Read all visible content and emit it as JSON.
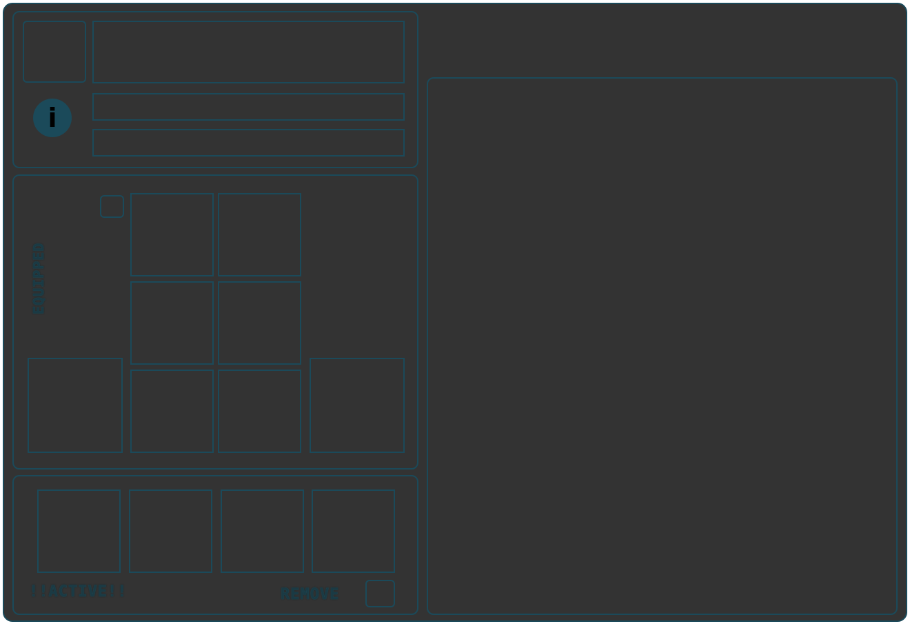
{
  "info_panel": {
    "info_icon": "info-icon",
    "info_glyph": "i"
  },
  "equipped_panel": {
    "label": "EQUIPPED"
  },
  "active_panel": {
    "active_label": "!!ACTIVE!!",
    "remove_label": "REMOVE"
  },
  "colors": {
    "background": "#333333",
    "accent": "#1b4a5a",
    "text": "#1a3a44"
  }
}
